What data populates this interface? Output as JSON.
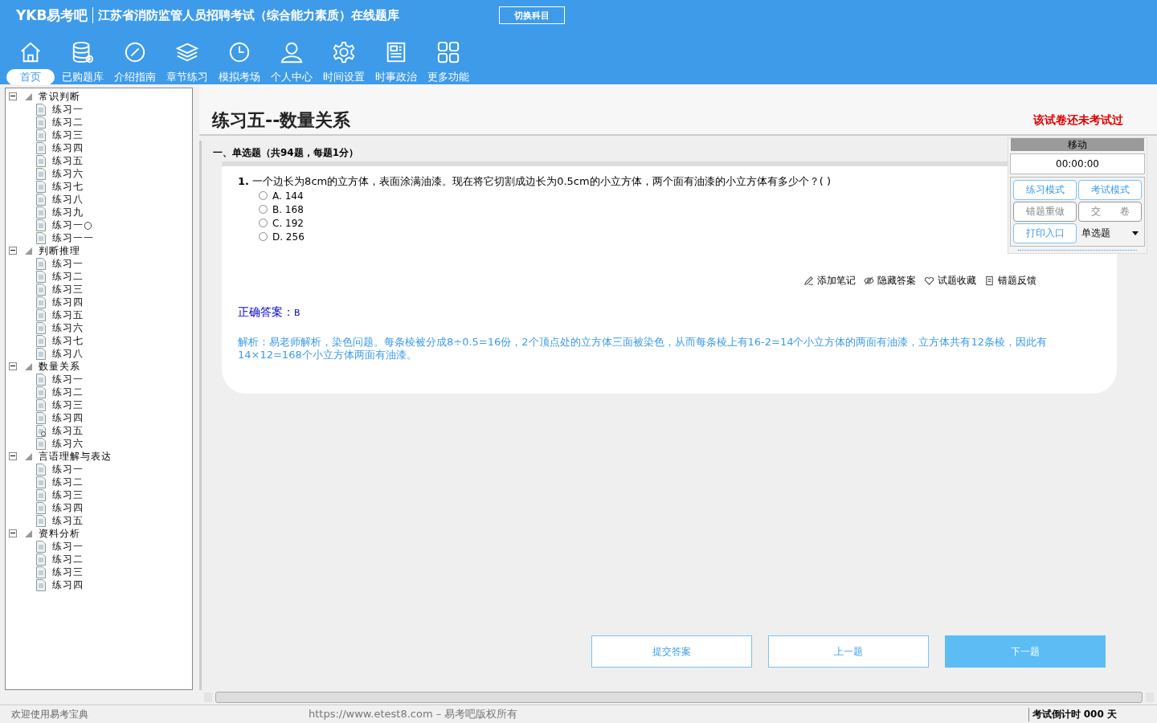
{
  "header": {
    "logo": "YKB易考吧",
    "title": "江苏省消防监管人员招聘考试（综合能力素质）在线题库",
    "switch_button": "切换科目"
  },
  "nav": [
    {
      "label": "首页",
      "kind": "home",
      "selected": true
    },
    {
      "label": "已购题库",
      "kind": "database",
      "selected": false
    },
    {
      "label": "介绍指南",
      "kind": "compass",
      "selected": false
    },
    {
      "label": "章节练习",
      "kind": "layers",
      "selected": false
    },
    {
      "label": "模拟考场",
      "kind": "clock",
      "selected": false
    },
    {
      "label": "个人中心",
      "kind": "user",
      "selected": false
    },
    {
      "label": "时间设置",
      "kind": "gear",
      "selected": false
    },
    {
      "label": "时事政治",
      "kind": "news",
      "selected": false
    },
    {
      "label": "更多功能",
      "kind": "grid",
      "selected": false
    }
  ],
  "tree": [
    {
      "label": "常识判断",
      "expanded": true,
      "children": [
        {
          "label": "练习一",
          "selected": false
        },
        {
          "label": "练习二",
          "selected": false
        },
        {
          "label": "练习三",
          "selected": false
        },
        {
          "label": "练习四",
          "selected": false
        },
        {
          "label": "练习五",
          "selected": false
        },
        {
          "label": "练习六",
          "selected": false
        },
        {
          "label": "练习七",
          "selected": false
        },
        {
          "label": "练习八",
          "selected": false
        },
        {
          "label": "练习九",
          "selected": false
        },
        {
          "label": "练习一○",
          "selected": false
        },
        {
          "label": "练习一一",
          "selected": false
        }
      ]
    },
    {
      "label": "判断推理",
      "expanded": true,
      "children": [
        {
          "label": "练习一",
          "selected": false
        },
        {
          "label": "练习二",
          "selected": false
        },
        {
          "label": "练习三",
          "selected": false
        },
        {
          "label": "练习四",
          "selected": false
        },
        {
          "label": "练习五",
          "selected": false
        },
        {
          "label": "练习六",
          "selected": false
        },
        {
          "label": "练习七",
          "selected": false
        },
        {
          "label": "练习八",
          "selected": false
        }
      ]
    },
    {
      "label": "数量关系",
      "expanded": true,
      "children": [
        {
          "label": "练习一",
          "selected": false
        },
        {
          "label": "练习二",
          "selected": false
        },
        {
          "label": "练习三",
          "selected": false
        },
        {
          "label": "练习四",
          "selected": false
        },
        {
          "label": "练习五",
          "selected": true
        },
        {
          "label": "练习六",
          "selected": false
        }
      ]
    },
    {
      "label": "言语理解与表达",
      "expanded": true,
      "children": [
        {
          "label": "练习一",
          "selected": false
        },
        {
          "label": "练习二",
          "selected": false
        },
        {
          "label": "练习三",
          "selected": false
        },
        {
          "label": "练习四",
          "selected": false
        },
        {
          "label": "练习五",
          "selected": false
        }
      ]
    },
    {
      "label": "资料分析",
      "expanded": true,
      "children": [
        {
          "label": "练习一",
          "selected": false
        },
        {
          "label": "练习二",
          "selected": false
        },
        {
          "label": "练习三",
          "selected": false
        },
        {
          "label": "练习四",
          "selected": false
        }
      ]
    }
  ],
  "paper": {
    "title": "练习五--数量关系",
    "status": "该试卷还未考试过",
    "section": "一、单选题（共94题，每题1分）"
  },
  "question": {
    "number": "1.",
    "text": "一个边长为8cm的立方体，表面涂满油漆。现在将它切割成边长为0.5cm的小立方体，两个面有油漆的小立方体有多少个？( )",
    "options": [
      {
        "label": "A. 144",
        "selected": false
      },
      {
        "label": "B. 168",
        "selected": false
      },
      {
        "label": "C. 192",
        "selected": false
      },
      {
        "label": "D. 256",
        "selected": false
      }
    ],
    "actions": [
      {
        "label": "添加笔记",
        "kind": "pen"
      },
      {
        "label": "隐藏答案",
        "kind": "eye"
      },
      {
        "label": "试题收藏",
        "kind": "heart"
      },
      {
        "label": "错题反馈",
        "kind": "doc"
      }
    ],
    "answer_label": "正确答案：",
    "answer": "B",
    "analysis": "解析：易老师解析，染色问题。每条棱被分成8÷0.5=16份，2个顶点处的立方体三面被染色，从而每条棱上有16-2=14个小立方体的两面有油漆，立方体共有12条棱，因此有14×12=168个小立方体两面有油漆。"
  },
  "side_panel": {
    "title": "移动",
    "timer": "00:00:00",
    "buttons": [
      {
        "label": "练习模式",
        "kind": "accent"
      },
      {
        "label": "考试模式",
        "kind": "accent"
      },
      {
        "label": "错题重做",
        "kind": "plain"
      },
      {
        "label": "交　　卷",
        "kind": "plain"
      },
      {
        "label": "打印入口",
        "kind": "accent"
      }
    ],
    "type_select": "单选题"
  },
  "footer_buttons": [
    {
      "label": "提交答案",
      "kind": "outline"
    },
    {
      "label": "上一题",
      "kind": "outline"
    },
    {
      "label": "下一题",
      "kind": "filled"
    }
  ],
  "status_bar": {
    "welcome": "欢迎使用易考宝典",
    "copyright": "https://www.etest8.com – 易考吧版权所有",
    "countdown": "考试倒计时 000 天"
  }
}
